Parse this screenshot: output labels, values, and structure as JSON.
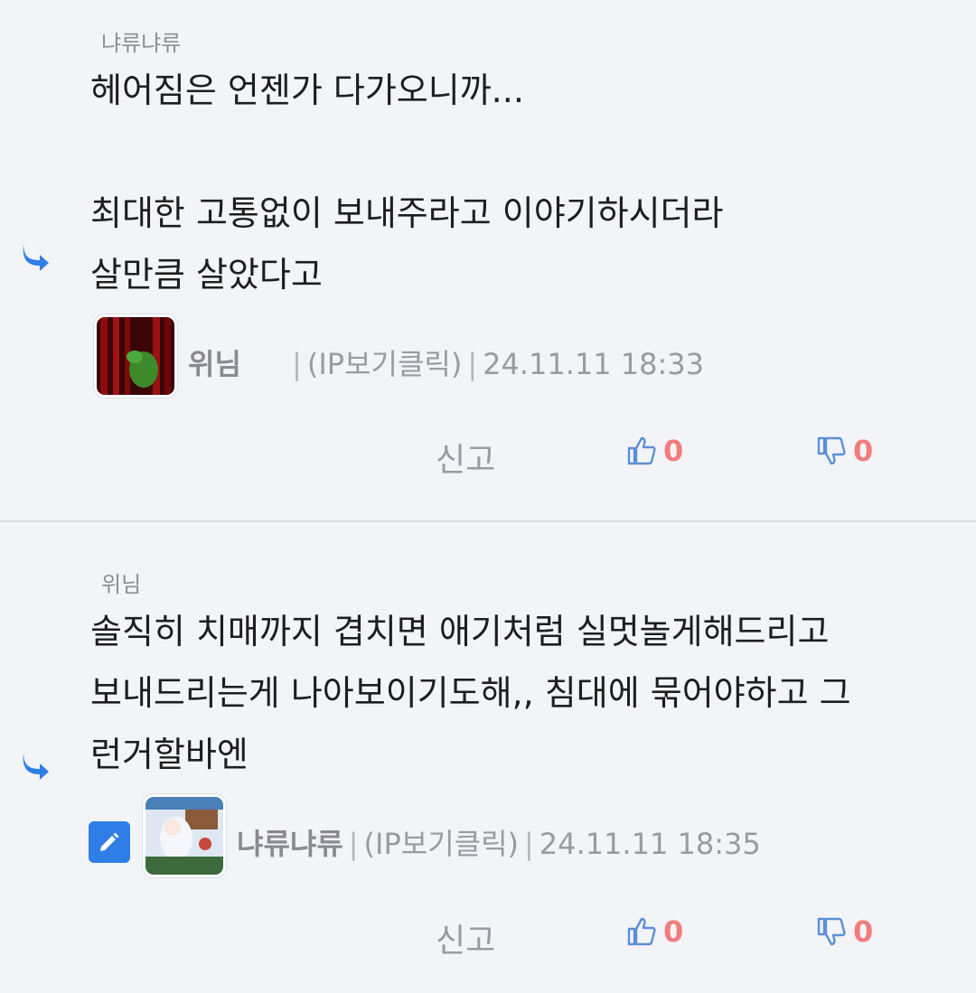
{
  "comments": [
    {
      "reply_to": "냐류냐류",
      "body": "헤어짐은 언젠가 다가오니까...\n\n최대한 고통없이 보내주라고 이야기하시더라\n살만큼 살았다고",
      "author": "위님",
      "ip_label": "(IP보기클릭)",
      "timestamp": "24.11.11 18:33",
      "report_label": "신고",
      "likes": "0",
      "dislikes": "0"
    },
    {
      "reply_to": "위님",
      "body": "솔직히 치매까지 겹치면 애기처럼 실멋놀게해드리고\n보내드리는게 나아보이기도해,, 침대에 묶어야하고 그\n런거할바엔",
      "author": "냐류냐류",
      "ip_label": "(IP보기클릭)",
      "timestamp": "24.11.11 18:35",
      "report_label": "신고",
      "likes": "0",
      "dislikes": "0"
    }
  ],
  "icons": {
    "reply": "reply-arrow-icon",
    "like": "thumbs-up-icon",
    "dislike": "thumbs-down-icon",
    "edit": "pencil-icon"
  },
  "colors": {
    "background": "#f3f4f7",
    "accent_blue": "#2f7ee6",
    "count_red": "#f27c7c",
    "muted": "#9a9aa0"
  }
}
